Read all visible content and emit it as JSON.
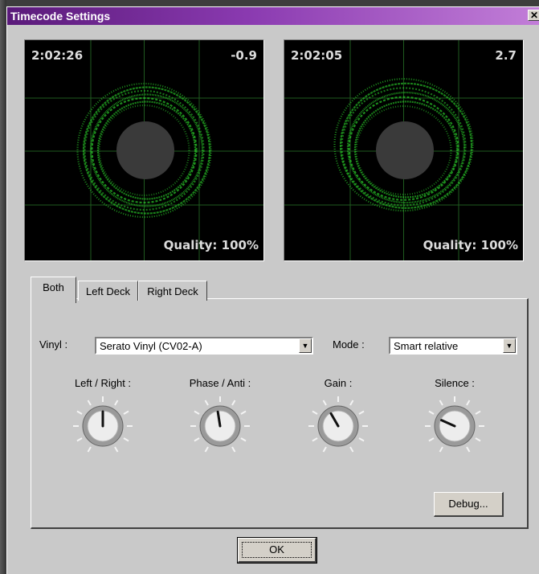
{
  "window": {
    "title": "Timecode Settings",
    "close_glyph": "✕"
  },
  "scopes": [
    {
      "time": "2:02:26",
      "value": "-0.9",
      "quality": "Quality: 100%"
    },
    {
      "time": "2:02:05",
      "value": "2.7",
      "quality": "Quality: 100%"
    }
  ],
  "tabs": [
    {
      "label": "Both",
      "active": true
    },
    {
      "label": "Left Deck",
      "active": false
    },
    {
      "label": "Right Deck",
      "active": false
    }
  ],
  "form": {
    "vinyl_label": "Vinyl :",
    "vinyl_value": "Serato Vinyl (CV02-A)",
    "mode_label": "Mode :",
    "mode_value": "Smart relative",
    "dropdown_icon": "▼"
  },
  "knobs": [
    {
      "label": "Left / Right :",
      "level": 0.5
    },
    {
      "label": "Phase / Anti :",
      "level": 0.47
    },
    {
      "label": "Gain :",
      "level": 0.4
    },
    {
      "label": "Silence :",
      "level": 0.28
    }
  ],
  "buttons": {
    "debug": "Debug...",
    "ok": "OK"
  },
  "colors": {
    "title_gradient_start": "#5a1a7a",
    "title_gradient_end": "#c27ed8",
    "scope_trace": "#2bd22b",
    "scope_grid": "#1f5a1f",
    "dialog_bg": "#c9c9c9"
  }
}
